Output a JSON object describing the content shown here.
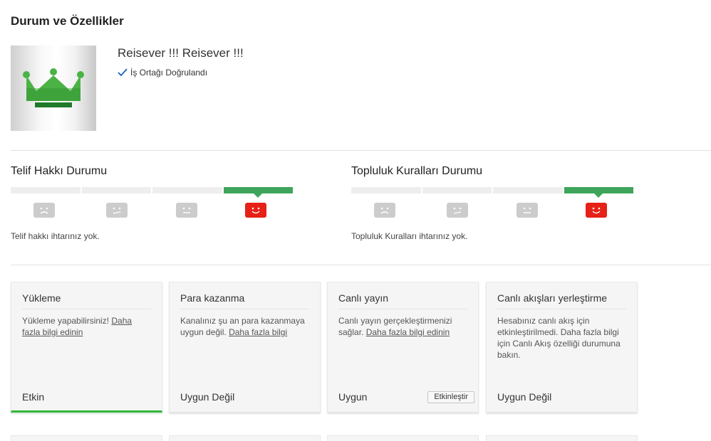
{
  "page": {
    "title": "Durum ve Özellikler"
  },
  "channel": {
    "name": "Reisever !!! Reisever !!!",
    "verified_label": "İş Ortağı Doğrulandı"
  },
  "copyright": {
    "title": "Telif Hakkı Durumu",
    "level": 4,
    "levels_total": 4,
    "message": "Telif hakkı ihtarınız yok."
  },
  "community": {
    "title": "Topluluk Kuralları Durumu",
    "level": 4,
    "levels_total": 4,
    "message": "Topluluk Kuralları ihtarınız yok."
  },
  "colors": {
    "good": "#3ea55a",
    "active_underline": "#2fb83a",
    "smile": "#e62117",
    "face_inactive": "#cccccc"
  },
  "cards": [
    {
      "title": "Yükleme",
      "desc_text": "Yükleme yapabilirsiniz! ",
      "link": "Daha fazla bilgi edinin",
      "status": "Etkin"
    },
    {
      "title": "Para kazanma",
      "desc_text": "Kanalınız şu an para kazanmaya uygun değil. ",
      "link": "Daha fazla bilgi",
      "status": "Uygun Değil"
    },
    {
      "title": "Canlı yayın",
      "desc_text": "Canlı yayın gerçekleştirmenizi sağlar. ",
      "link": "Daha fazla bilgi edinin",
      "status": "Uygun",
      "button": "Etkinleştir"
    },
    {
      "title": "Canlı akışları yerleştirme",
      "desc_text": "Hesabınız canlı akış için etkinleştirilmedi. Daha fazla bilgi için Canlı Akış özelliği durumuna bakın.",
      "status": "Uygun Değil"
    }
  ]
}
